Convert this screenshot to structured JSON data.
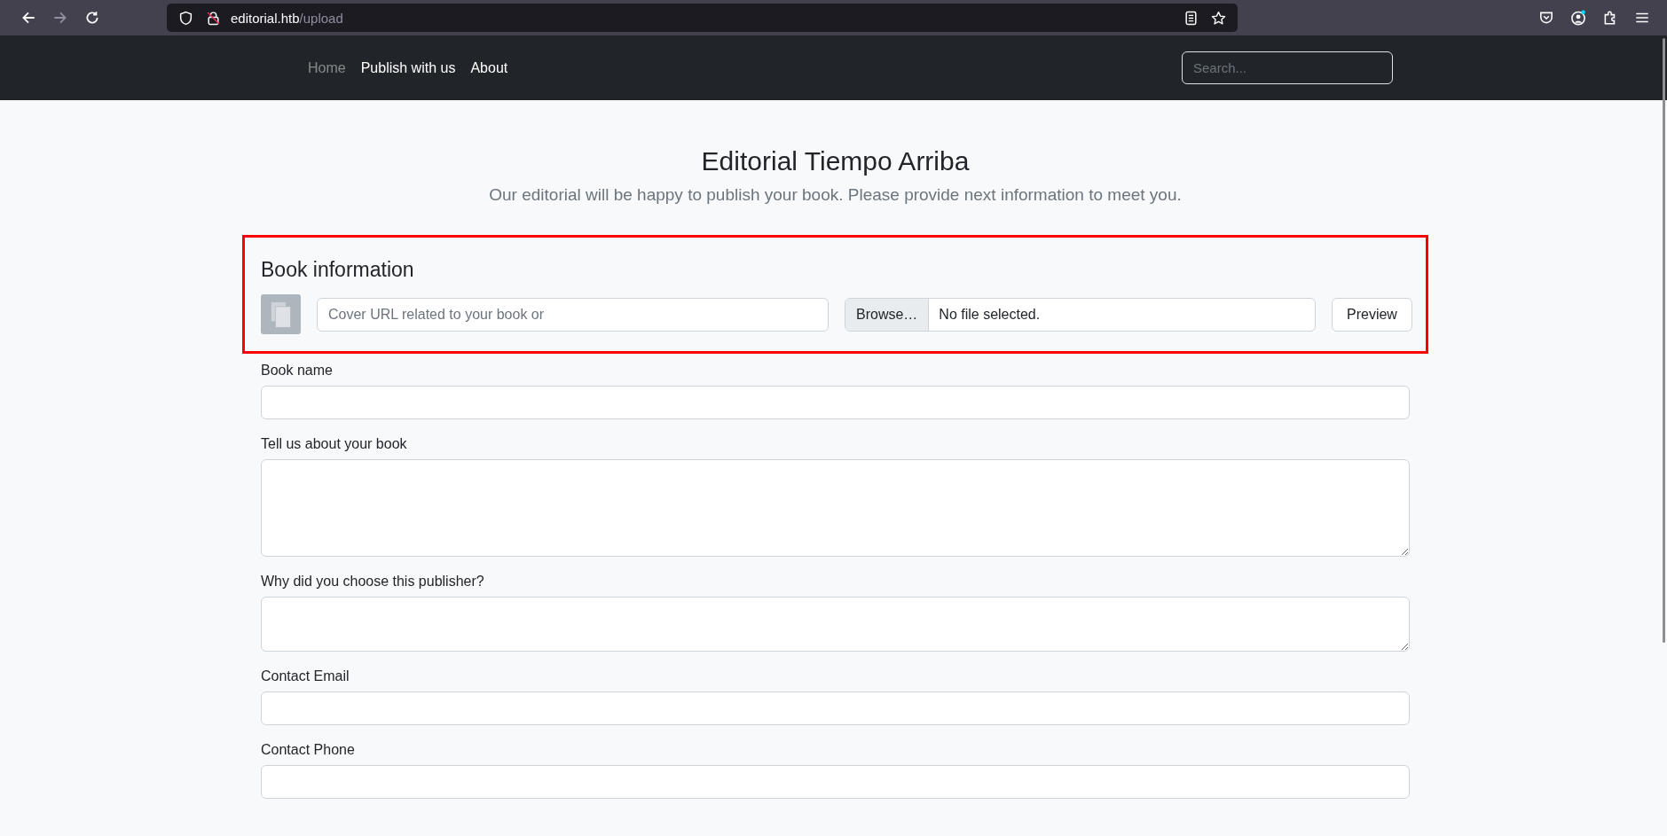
{
  "browser": {
    "url_host": "editorial.htb",
    "url_path": "/upload",
    "forward_disabled": true
  },
  "navbar": {
    "links": [
      {
        "label": "Home",
        "dimmed": true
      },
      {
        "label": "Publish with us",
        "dimmed": false
      },
      {
        "label": "About",
        "dimmed": false
      }
    ],
    "search": {
      "placeholder": "Search..."
    }
  },
  "header": {
    "title": "Editorial Tiempo Arriba",
    "subtitle": "Our editorial will be happy to publish your book. Please provide next information to meet you."
  },
  "book_information": {
    "heading": "Book information",
    "url_placeholder": "Cover URL related to your book or",
    "browse_label": "Browse…",
    "file_status": "No file selected.",
    "preview_button": "Preview"
  },
  "fields": [
    {
      "label": "Book name",
      "kind": "text"
    },
    {
      "label": "Tell us about your book",
      "kind": "textarea"
    },
    {
      "label": "Why did you choose this publisher?",
      "kind": "textarea-small"
    },
    {
      "label": "Contact Email",
      "kind": "text"
    },
    {
      "label": "Contact Phone",
      "kind": "text"
    }
  ]
}
